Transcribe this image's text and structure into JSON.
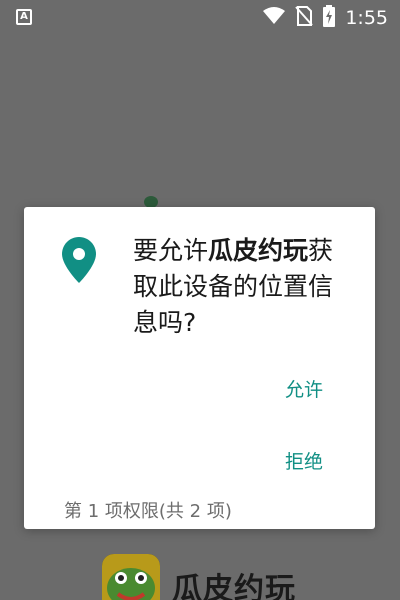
{
  "status_bar": {
    "left_icon": "A",
    "time": "1:55",
    "icons": [
      "wifi-icon",
      "no-sim-icon",
      "battery-charging-icon"
    ]
  },
  "background_app": {
    "name": "瓜皮约玩"
  },
  "permission_dialog": {
    "icon": "location-pin-icon",
    "message_prefix": "要允许",
    "app_name": "瓜皮约玩",
    "message_suffix": "获取此设备的位置信息吗?",
    "allow_label": "允许",
    "deny_label": "拒绝",
    "footer": "第 1 项权限(共 2 项)",
    "accent_color": "#118f84"
  }
}
